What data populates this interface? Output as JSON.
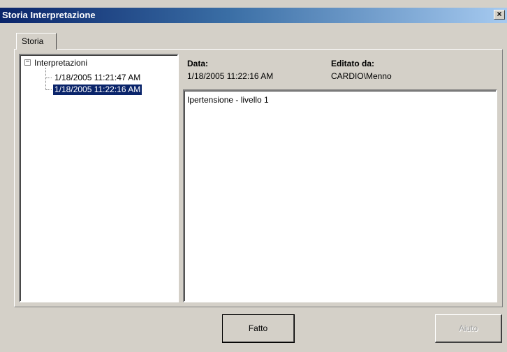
{
  "window": {
    "title": "Storia Interpretazione",
    "close_glyph": "×"
  },
  "tabs": [
    {
      "label": "Storia"
    }
  ],
  "tree": {
    "expander_glyph": "−",
    "root_label": "Interpretazioni",
    "items": [
      {
        "label": "1/18/2005 11:21:47 AM",
        "selected": false
      },
      {
        "label": "1/18/2005 11:22:16 AM",
        "selected": true
      }
    ]
  },
  "details": {
    "date_label": "Data:",
    "date_value": "1/18/2005 11:22:16 AM",
    "editor_label": "Editato da:",
    "editor_value": "CARDIO\\Menno",
    "notes_text": "Ipertensione - livello 1"
  },
  "buttons": {
    "done_label": "Fatto",
    "help_label": "Aiuto"
  }
}
